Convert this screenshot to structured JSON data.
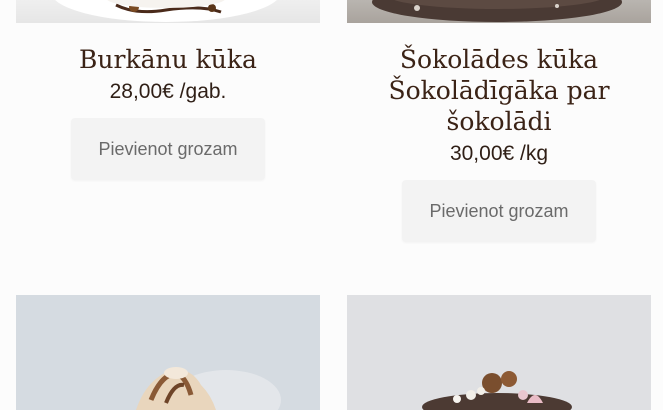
{
  "products": [
    {
      "title": "Burkānu kūka",
      "price": "28,00€ /gab.",
      "button": "Pievienot grozam"
    },
    {
      "title_line1": "Šokolādes kūka",
      "title_line2": "Šokolādīgāka par",
      "title_line3": "šokolādi",
      "price": "30,00€ /kg",
      "button": "Pievienot grozam"
    }
  ]
}
